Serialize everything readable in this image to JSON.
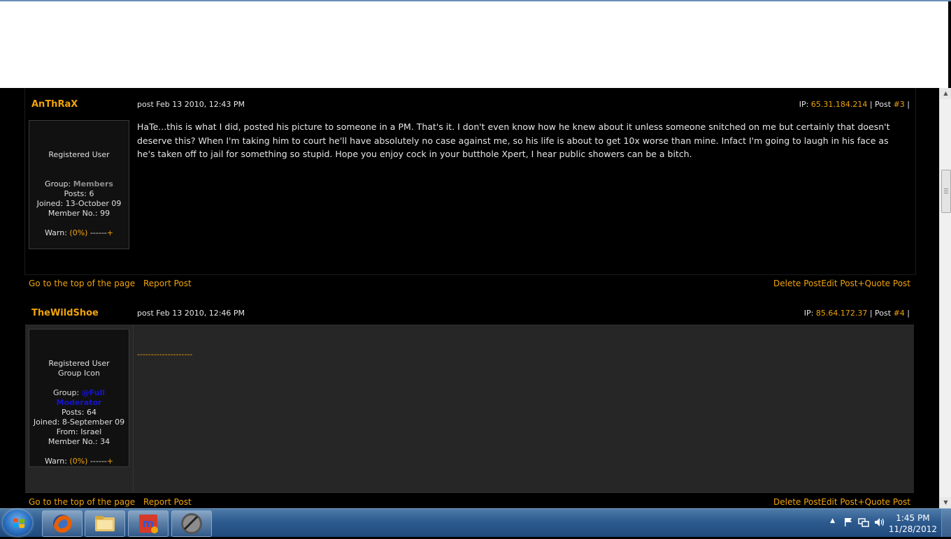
{
  "posts": [
    {
      "author": "AnThRaX",
      "date": "post Feb 13 2010, 12:43 PM",
      "ip_label": "IP: ",
      "ip": "65.31.184.214",
      "post_label": " | Post ",
      "post_num": "#3",
      "post_end": " |",
      "profile": {
        "title": "Registered User",
        "group_label": "Group: ",
        "group": "Members",
        "posts": "Posts: 6",
        "joined": "Joined: 13-October 09",
        "member_no": "Member No.: 99",
        "warn_label": "Warn: ",
        "warn_value": "(0%)",
        "warn_bar": " ------",
        "warn_plus": "+"
      },
      "body": "HaTe...this is what I did, posted his picture to someone in a PM. That's it. I don't even know how he knew about it unless someone snitched on me but certainly that doesn't deserve this? When I'm taking him to court he'll have absolutely no case against me, so his life is about to get 10x worse than mine. Infact I'm going to laugh in his face as he's taken off to jail for something so stupid. Hope you enjoy cock in your butthole Xpert, I hear public showers can be a bitch."
    },
    {
      "author": "TheWildShoe",
      "date": "post Feb 13 2010, 12:46 PM",
      "ip_label": "IP: ",
      "ip": "85.64.172.37",
      "post_label": " | Post ",
      "post_num": "#4",
      "post_end": " |",
      "profile": {
        "title": "Registered User",
        "group_icon": "Group Icon",
        "group_label": "Group: ",
        "group": "@Full Moderator",
        "posts": "Posts: 64",
        "joined": "Joined: 8-September 09",
        "from": "From: Israel",
        "member_no": "Member No.: 34",
        "warn_label": "Warn: ",
        "warn_value": "(0%)",
        "warn_bar": " ------",
        "warn_plus": "+"
      },
      "body": "--------------------"
    }
  ],
  "links": {
    "top": "Go to the top of the page",
    "report": "Report Post",
    "delete": "Delete Post",
    "edit": "Edit Post",
    "quote": "+Quote Post"
  },
  "taskbar": {
    "time": "1:45 PM",
    "date": "11/28/2012",
    "apps": [
      "firefox-icon",
      "windows-explorer-icon",
      "media-player-icon",
      "clipper-icon"
    ]
  },
  "colors": {
    "accent": "#f0a30a",
    "background": "#000000",
    "moderator_group": "#1515d0"
  }
}
